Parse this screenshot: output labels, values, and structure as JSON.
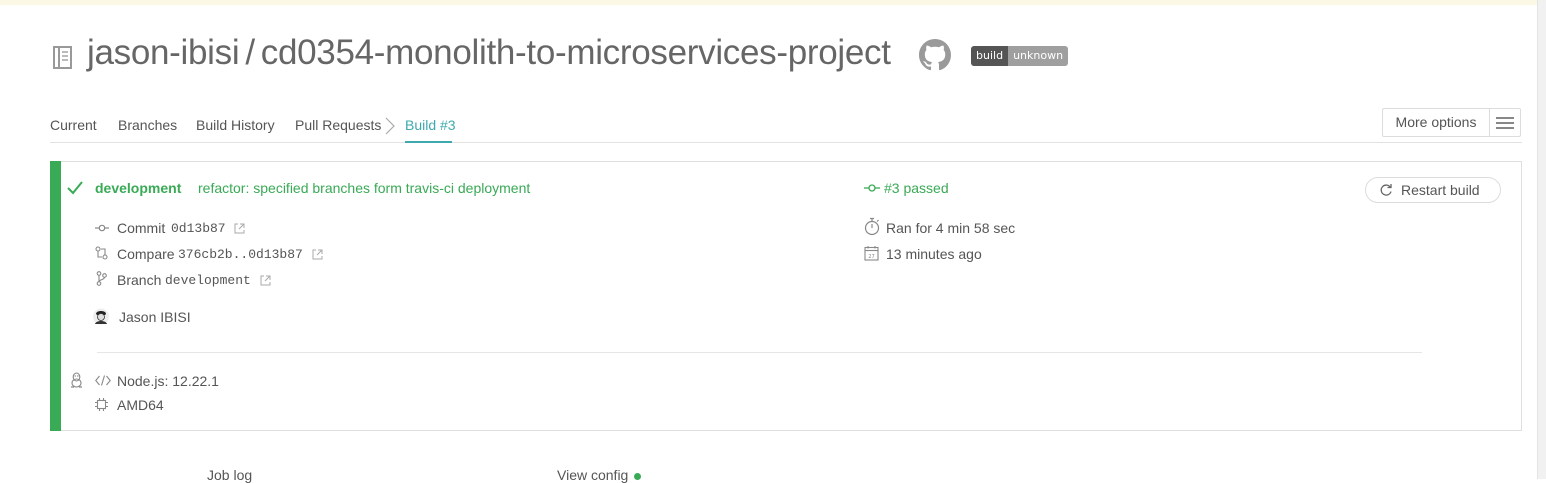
{
  "repo": {
    "owner": "jason-ibisi",
    "separator": "/",
    "name": "cd0354-monolith-to-microservices-project",
    "badge_left": "build",
    "badge_right": "unknown"
  },
  "tabs": [
    {
      "label": "Current"
    },
    {
      "label": "Branches"
    },
    {
      "label": "Build History"
    },
    {
      "label": "Pull Requests"
    },
    {
      "label": "Build #3"
    }
  ],
  "more_options_label": "More options",
  "build": {
    "branch": "development",
    "message": "refactor: specified branches form travis-ci deployment",
    "status": "#3 passed",
    "restart_label": "Restart build",
    "commit_label": "Commit",
    "commit_value": "0d13b87",
    "compare_label": "Compare",
    "compare_value": "376cb2b..0d13b87",
    "branch_label": "Branch",
    "branch_value": "development",
    "author": "Jason IBISI",
    "duration": "Ran for 4 min 58 sec",
    "finished": "13 minutes ago",
    "language": "Node.js: 12.22.1",
    "arch": "AMD64"
  },
  "bottom": {
    "job_log": "Job log",
    "view_config": "View config"
  },
  "colors": {
    "passed_green": "#39aa56",
    "accent_teal": "#3eaaaf"
  },
  "icons": [
    "repo-icon",
    "github-icon",
    "chevron-right-icon",
    "hamburger-icon",
    "check-icon",
    "commit-icon",
    "compare-icon",
    "branch-icon",
    "external-link-icon",
    "avatar",
    "restart-icon",
    "stopwatch-icon",
    "calendar-icon",
    "linux-icon",
    "code-icon",
    "cpu-icon"
  ]
}
